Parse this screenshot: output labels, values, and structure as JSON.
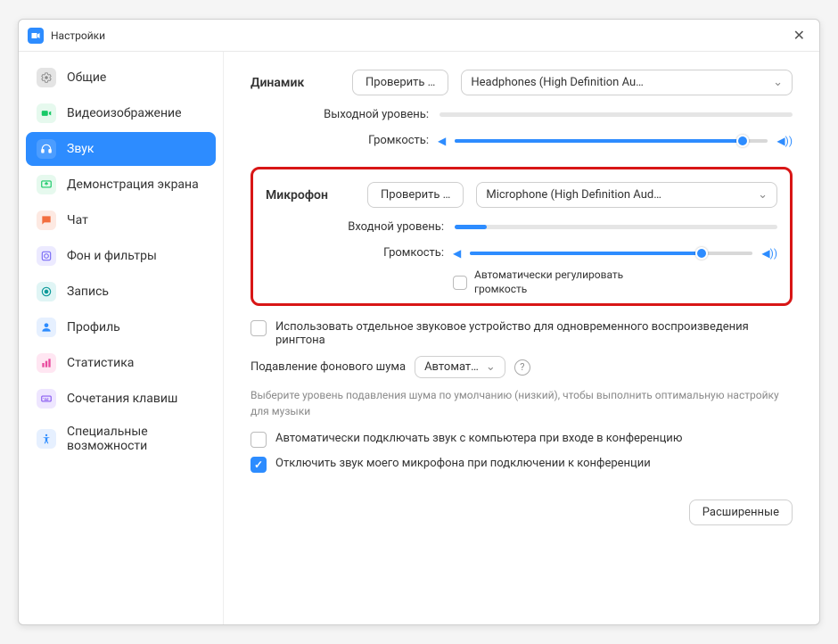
{
  "titlebar": {
    "title": "Настройки"
  },
  "sidebar": {
    "items": [
      {
        "label": "Общие",
        "icon": "gear",
        "color": "#e4e4e4",
        "fg": "#888"
      },
      {
        "label": "Видеоизображение",
        "icon": "video",
        "color": "#e6f9ee",
        "fg": "#18c967"
      },
      {
        "label": "Звук",
        "icon": "audio",
        "color": "#fff",
        "fg": "#fff",
        "active": true
      },
      {
        "label": "Демонстрация экрана",
        "icon": "share",
        "color": "#e6f9ee",
        "fg": "#18c967"
      },
      {
        "label": "Чат",
        "icon": "chat",
        "color": "#fde9e2",
        "fg": "#f26d3d"
      },
      {
        "label": "Фон и фильтры",
        "icon": "background",
        "color": "#eceaff",
        "fg": "#7b6ef6"
      },
      {
        "label": "Запись",
        "icon": "record",
        "color": "#e0f5f5",
        "fg": "#0e9a9a"
      },
      {
        "label": "Профиль",
        "icon": "profile",
        "color": "#e6f0ff",
        "fg": "#2d8cff"
      },
      {
        "label": "Статистика",
        "icon": "stats",
        "color": "#ffe6f2",
        "fg": "#e84b9e"
      },
      {
        "label": "Сочетания клавиш",
        "icon": "keyboard",
        "color": "#eee6ff",
        "fg": "#8a5cf0"
      },
      {
        "label": "Специальные возможности",
        "icon": "access",
        "color": "#e6f0ff",
        "fg": "#2d8cff"
      }
    ]
  },
  "speaker": {
    "title": "Динамик",
    "test_button": "Проверить …",
    "device": "Headphones (High Definition Au…",
    "output_level_label": "Выходной уровень:",
    "volume_label": "Громкость:",
    "volume_pct": 92
  },
  "mic": {
    "title": "Микрофон",
    "test_button": "Проверить …",
    "device": "Microphone (High Definition Aud…",
    "input_level_label": "Входной уровень:",
    "input_level_pct": 10,
    "volume_label": "Громкость:",
    "volume_pct": 82,
    "auto_adjust_label": "Автоматически регулировать громкость",
    "auto_adjust_checked": false
  },
  "options": {
    "separate_ringtone": {
      "label": "Использовать отдельное звуковое устройство для одновременного воспроизведения рингтона",
      "checked": false
    },
    "noise_suppress_label": "Подавление фонового шума",
    "noise_suppress_value": "Автомат…",
    "noise_hint": "Выберите уровень подавления шума по умолчанию (низкий), чтобы выполнить оптимальную настройку для музыки",
    "auto_join_audio": {
      "label": "Автоматически подключать звук с компьютера при входе в конференцию",
      "checked": false
    },
    "mute_on_join": {
      "label": "Отключить звук моего микрофона при подключении к конференции",
      "checked": true
    }
  },
  "footer": {
    "advanced": "Расширенные"
  }
}
